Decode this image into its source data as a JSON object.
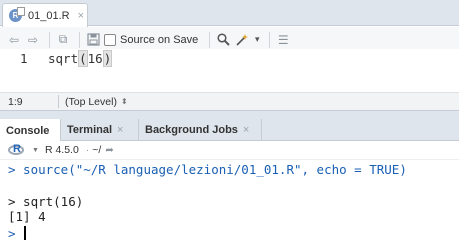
{
  "editor": {
    "tab_label": "01_01.R",
    "tab_close": "×",
    "source_on_save_label": "Source on Save",
    "line_number": "1",
    "code_prefix": "sqrt",
    "code_open_paren": "(",
    "code_arg": "16",
    "code_close_paren": ")"
  },
  "statusbar": {
    "cursor_position": "1:9",
    "scope_label": "(Top Level)",
    "scope_arrows": "⬍"
  },
  "console_tabs": [
    {
      "label": "Console",
      "close": ""
    },
    {
      "label": "Terminal",
      "close": "×"
    },
    {
      "label": "Background Jobs",
      "close": "×"
    }
  ],
  "console": {
    "r_version": "R 4.5.0",
    "working_dir": "~/",
    "lines": [
      "> source(\"~/R language/lezioni/01_01.R\", echo = TRUE)",
      "> sqrt(16)",
      "[1] 4",
      ">"
    ]
  },
  "icons": {
    "back": "⇦",
    "forward": "⇨",
    "show_in_window": "⧉",
    "save": "▭",
    "search": "🔍",
    "wand": "✨",
    "dropdown": "▾",
    "outline": "☰"
  }
}
